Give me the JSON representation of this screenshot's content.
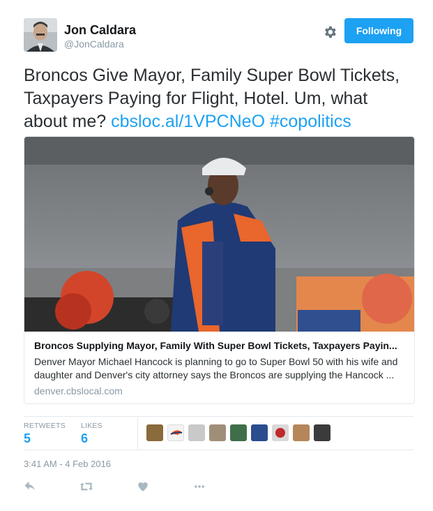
{
  "header": {
    "display_name": "Jon Caldara",
    "handle": "@JonCaldara",
    "follow_button": "Following",
    "settings_icon": "gear-icon",
    "accent_color": "#1da1f2"
  },
  "tweet": {
    "text": "Broncos Give Mayor, Family Super Bowl Tickets, Taxpayers Paying for Flight, Hotel. Um, what about me?",
    "link": "cbsloc.al/1VPCNeO",
    "hashtag": "#copolitics"
  },
  "card": {
    "title": "Broncos Supplying Mayor, Family With Super Bowl Tickets, Taxpayers Payin...",
    "description": "Denver Mayor Michael Hancock is planning to go to Super Bowl 50 with his wife and daughter and Denver's city attorney says the Broncos are supplying the Hancock ...",
    "domain": "denver.cbslocal.com"
  },
  "stats": {
    "retweets_label": "RETWEETS",
    "retweets_value": "5",
    "likes_label": "LIKES",
    "likes_value": "6"
  },
  "timestamp": "3:41 AM - 4 Feb 2016",
  "actions": [
    "reply-icon",
    "retweet-icon",
    "heart-icon",
    "more-icon"
  ]
}
